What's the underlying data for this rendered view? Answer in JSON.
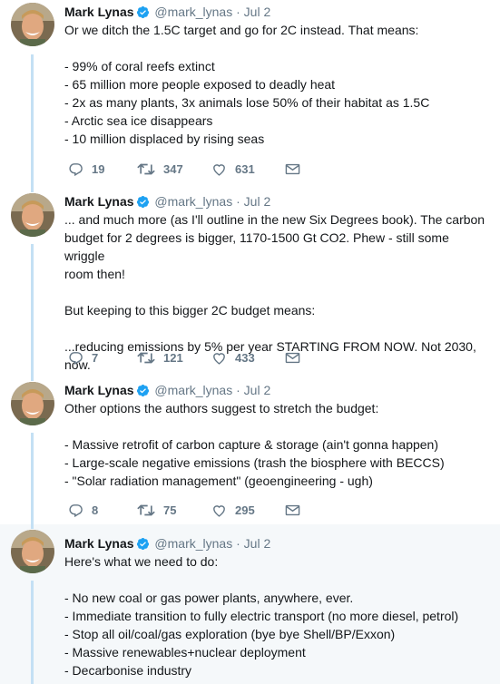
{
  "tweets": [
    {
      "name": "Mark Lynas",
      "handle": "@mark_lynas",
      "dot": "·",
      "date": "Jul 2",
      "lines": [
        "Or we ditch the 1.5C target and go for 2C instead. That means:",
        "",
        "- 99% of coral reefs extinct",
        "- 65 million more people exposed to deadly heat",
        "- 2x as many plants, 3x animals lose 50% of their habitat as 1.5C",
        "- Arctic sea ice disappears",
        "- 10 million displaced by rising seas"
      ],
      "replies": "19",
      "retweets": "347",
      "likes": "631"
    },
    {
      "name": "Mark Lynas",
      "handle": "@mark_lynas",
      "dot": "·",
      "date": "Jul 2",
      "lines": [
        "... and much more (as I'll outline in the new Six Degrees book). The carbon",
        "budget for 2 degrees is bigger, 1170-1500 Gt CO2. Phew - still some wriggle",
        "room then!",
        "",
        "But keeping to this bigger 2C budget means:",
        "",
        "...reducing emissions by 5% per year STARTING FROM NOW. Not 2030, now."
      ],
      "replies": "7",
      "retweets": "121",
      "likes": "433"
    },
    {
      "name": "Mark Lynas",
      "handle": "@mark_lynas",
      "dot": "·",
      "date": "Jul 2",
      "lines": [
        "Other options the authors suggest to stretch the budget:",
        "",
        "- Massive retrofit of carbon capture & storage (ain't gonna happen)",
        "- Large-scale negative emissions (trash the biosphere with BECCS)",
        "- \"Solar radiation management\" (geoengineering - ugh)"
      ],
      "replies": "8",
      "retweets": "75",
      "likes": "295"
    },
    {
      "name": "Mark Lynas",
      "handle": "@mark_lynas",
      "dot": "·",
      "date": "Jul 2",
      "lines": [
        "Here's what we need to do:",
        "",
        "- No new coal or gas power plants, anywhere, ever.",
        "- Immediate transition to fully electric transport (no more diesel, petrol)",
        "- Stop all oil/coal/gas exploration (bye bye Shell/BP/Exxon)",
        "- Massive renewables+nuclear deployment",
        "- Decarbonise industry"
      ]
    }
  ],
  "colors": {
    "thread_line": "#c4e0f4",
    "verified": "#1da1f2",
    "muted": "#657786",
    "highlight_bg": "#f5f8fa"
  },
  "icons": {
    "reply": "reply-icon",
    "retweet": "retweet-icon",
    "like": "heart-icon",
    "dm": "envelope-icon",
    "verified": "verified-badge-icon"
  }
}
